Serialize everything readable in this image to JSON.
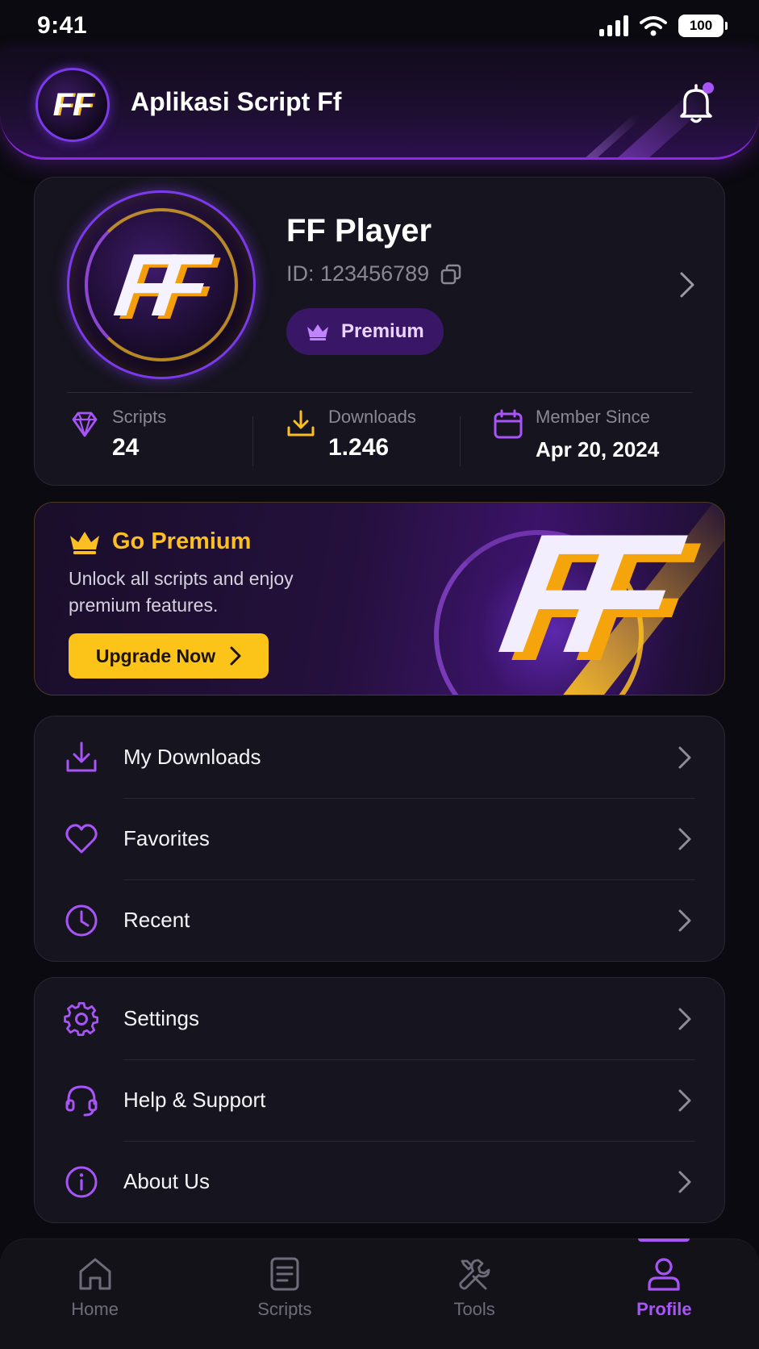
{
  "status_bar": {
    "time": "9:41",
    "battery": "100"
  },
  "header": {
    "title": "Aplikasi Script Ff",
    "logo_text": "FF"
  },
  "profile": {
    "avatar_text": "FF",
    "name": "FF Player",
    "id_text": "ID: 123456789",
    "badge": "Premium",
    "stats": [
      {
        "label": "Scripts",
        "value": "24",
        "icon": "diamond-icon"
      },
      {
        "label": "Downloads",
        "value": "1.246",
        "icon": "download-icon"
      },
      {
        "label": "Member Since",
        "value": "Apr 20, 2024",
        "icon": "calendar-icon"
      }
    ]
  },
  "promo": {
    "title": "Go Premium",
    "text": "Unlock all scripts and enjoy premium features.",
    "button": "Upgrade Now",
    "art_text": "FF"
  },
  "menu_group_1": [
    {
      "label": "My Downloads",
      "icon": "download-icon"
    },
    {
      "label": "Favorites",
      "icon": "heart-icon"
    },
    {
      "label": "Recent",
      "icon": "clock-icon"
    }
  ],
  "menu_group_2": [
    {
      "label": "Settings",
      "icon": "gear-icon"
    },
    {
      "label": "Help & Support",
      "icon": "headset-icon"
    },
    {
      "label": "About Us",
      "icon": "info-icon"
    }
  ],
  "bottom_nav": [
    {
      "label": "Home",
      "icon": "home-icon"
    },
    {
      "label": "Scripts",
      "icon": "document-icon"
    },
    {
      "label": "Tools",
      "icon": "tools-icon"
    },
    {
      "label": "Profile",
      "icon": "user-icon",
      "active": true
    }
  ],
  "colors": {
    "accent": "#a855f7",
    "gold": "#fcc419",
    "background": "#0b0a10",
    "card": "#16141e"
  }
}
